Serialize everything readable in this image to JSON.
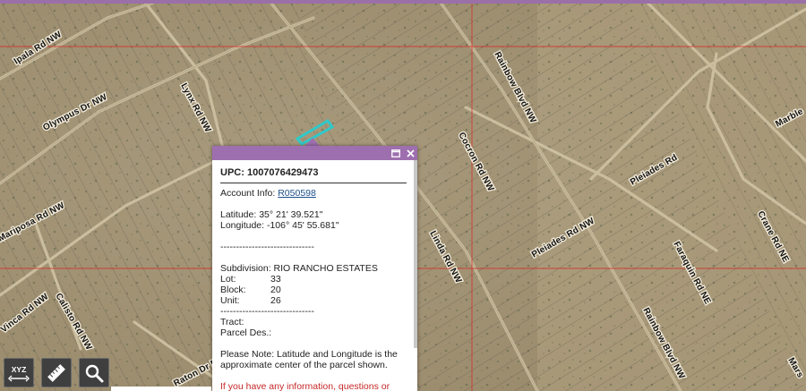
{
  "map": {
    "road_labels": [
      "Ipala Rd NW",
      "Olympus Dr NW",
      "Lynx Rd NW",
      "Mariposa Rd NW",
      "Vinca Rd NW",
      "Calisto Rd NW",
      "Raton Dr NW",
      "Cocron Rd NW",
      "Rainbow Blvd NW",
      "Pleiades Rd",
      "Pleiades Rd NW",
      "Linda Rd NW",
      "Faraquin Rd NE",
      "Rainbow Blvd NW",
      "Crane Rd NE",
      "Marble",
      "Mars"
    ]
  },
  "popup": {
    "upc_label": "UPC:",
    "upc_value": "1007076429473",
    "account_label": "Account Info:",
    "account_link": "R050598",
    "latitude_label": "Latitude:",
    "latitude_value": "35° 21' 39.521\"",
    "longitude_label": "Longitude:",
    "longitude_value": "-106° 45' 55.681\"",
    "divider": "------------------------------",
    "subdivision_label": "Subdivision:",
    "subdivision_value": "RIO RANCHO ESTATES",
    "lot_label": "Lot:",
    "lot_value": "33",
    "block_label": "Block:",
    "block_value": "20",
    "unit_label": "Unit:",
    "unit_value": "26",
    "divider2": "------------------------------",
    "tract_label": "Tract:",
    "parcel_label": "Parcel Des.:",
    "note": "Please Note: Latitude and Longitude is the approximate center of the parcel shown.",
    "warning": "If you have any information, questions or"
  },
  "tools": {
    "xyz_label": "XYZ",
    "icons": [
      "xyz-icon",
      "ruler-icon",
      "search-icon"
    ]
  },
  "colors": {
    "accent": "#9e6fae",
    "tool_bg": "#3f3f3f",
    "link": "#1d4f8c",
    "warning": "#c62828",
    "parcel_highlight": "#2fc9c9"
  }
}
